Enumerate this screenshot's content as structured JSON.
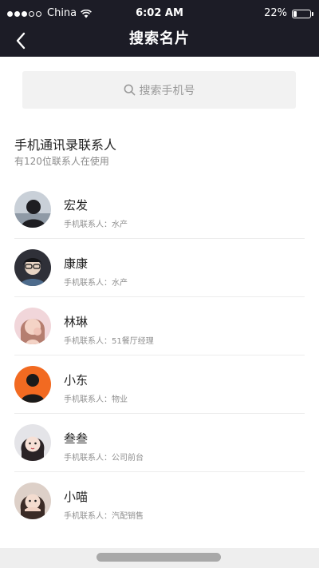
{
  "status_bar": {
    "carrier": "China",
    "time": "6:02 AM",
    "battery": "22%",
    "battery_level": 0.22
  },
  "nav": {
    "title": "搜索名片",
    "back_icon": "chevron-left-icon"
  },
  "search": {
    "placeholder": "搜索手机号",
    "icon": "search-icon"
  },
  "section": {
    "title": "手机通讯录联系人",
    "subtitle": "有120位联系人在使用"
  },
  "contacts": [
    {
      "name": "宏发",
      "info": "手机联系人：水产",
      "avatar_color": "#7b8794"
    },
    {
      "name": "康康",
      "info": "手机联系人：水产",
      "avatar_color": "#3a3a44"
    },
    {
      "name": "林琳",
      "info": "手机联系人：51餐厅经理",
      "avatar_color": "#e3b5bd"
    },
    {
      "name": "小东",
      "info": "手机联系人：物业",
      "avatar_color": "#f26a21"
    },
    {
      "name": "叁叁",
      "info": "手机联系人：公司前台",
      "avatar_color": "#d9d9dc"
    },
    {
      "name": "小喵",
      "info": "手机联系人：汽配销售",
      "avatar_color": "#c9b2a5"
    }
  ]
}
